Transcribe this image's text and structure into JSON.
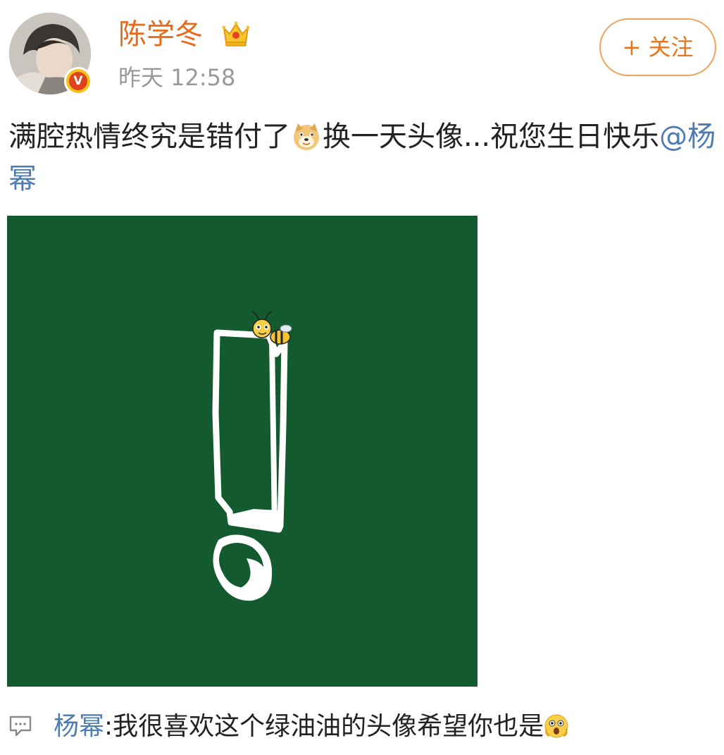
{
  "post": {
    "author": {
      "name": "陈学冬",
      "verified_badge": "V",
      "vip_icon": "crown-icon"
    },
    "time": "昨天 12:58",
    "follow_label": "+ 关注",
    "text_before_emoji": "满腔热情终究是错付了",
    "emoji": "doge-icon",
    "text_after_emoji": "换一天头像...祝您生日快乐",
    "mention": "@杨幂",
    "image": {
      "description_icon": "exclamation-mark-with-bee",
      "background_color": "#135b2e"
    }
  },
  "comment": {
    "icon": "comment-icon",
    "author": "杨幂",
    "separator": ":",
    "text": "我很喜欢这个绿油油的头像希望你也是",
    "emoji": "shock-icon"
  },
  "colors": {
    "username": "#e86b1c",
    "follow": "#e8761e",
    "link": "#4e7cb0",
    "timestamp": "#999999"
  }
}
